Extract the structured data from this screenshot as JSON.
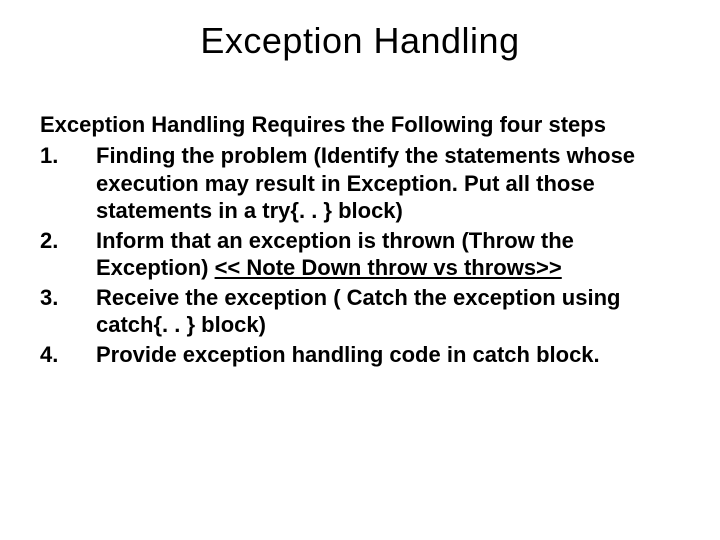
{
  "title": "Exception Handling",
  "subtitle": "Exception Handling Requires the Following four steps",
  "steps": {
    "item1": "Finding the problem (Identify the statements whose execution may result in Exception. Put all those statements in a try{. . } block)",
    "item2_pre": "Inform that an exception is thrown (Throw the Exception) ",
    "item2_note": "<< Note Down throw vs throws>>",
    "item3": "Receive the exception ( Catch the exception using catch{. . } block)",
    "item4": "Provide exception handling code in catch block."
  }
}
